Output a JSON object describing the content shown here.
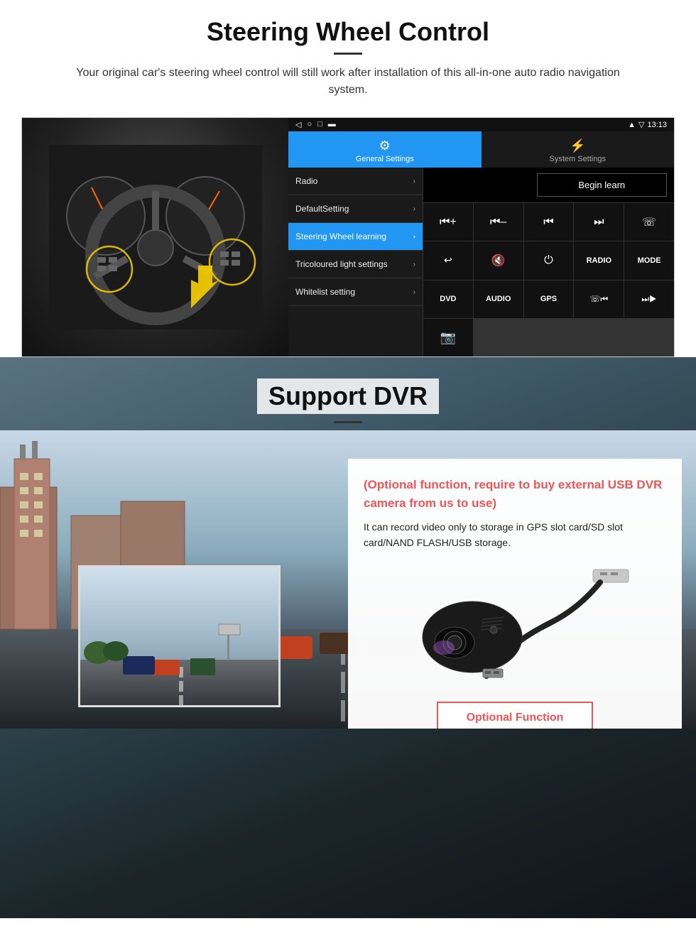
{
  "section1": {
    "title": "Steering Wheel Control",
    "subtitle": "Your original car's steering wheel control will still work after installation of this all-in-one auto radio navigation system.",
    "android": {
      "statusbar": {
        "time": "13:13",
        "icons": [
          "▲",
          "▼",
          "◀"
        ]
      },
      "tabs": [
        {
          "label": "General Settings",
          "icon": "⚙",
          "active": true
        },
        {
          "label": "System Settings",
          "icon": "⚡",
          "active": false
        }
      ],
      "menu": [
        {
          "label": "Radio",
          "active": false
        },
        {
          "label": "DefaultSetting",
          "active": false
        },
        {
          "label": "Steering Wheel learning",
          "active": true
        },
        {
          "label": "Tricoloured light settings",
          "active": false
        },
        {
          "label": "Whitelist setting",
          "active": false
        }
      ],
      "begin_learn": "Begin learn",
      "controls": [
        "⏮+",
        "⏮–",
        "⏮|",
        "|▶▶",
        "☎",
        "↩",
        "🔇×",
        "⏻",
        "RADIO",
        "MODE",
        "DVD",
        "AUDIO",
        "GPS",
        "☎⏮|",
        "⏭|▶"
      ]
    }
  },
  "section2": {
    "title": "Support DVR",
    "optional_title": "(Optional function, require to buy external USB DVR camera from us to use)",
    "description": "It can record video only to storage in GPS slot card/SD slot card/NAND FLASH/USB storage.",
    "optional_btn": "Optional Function"
  }
}
